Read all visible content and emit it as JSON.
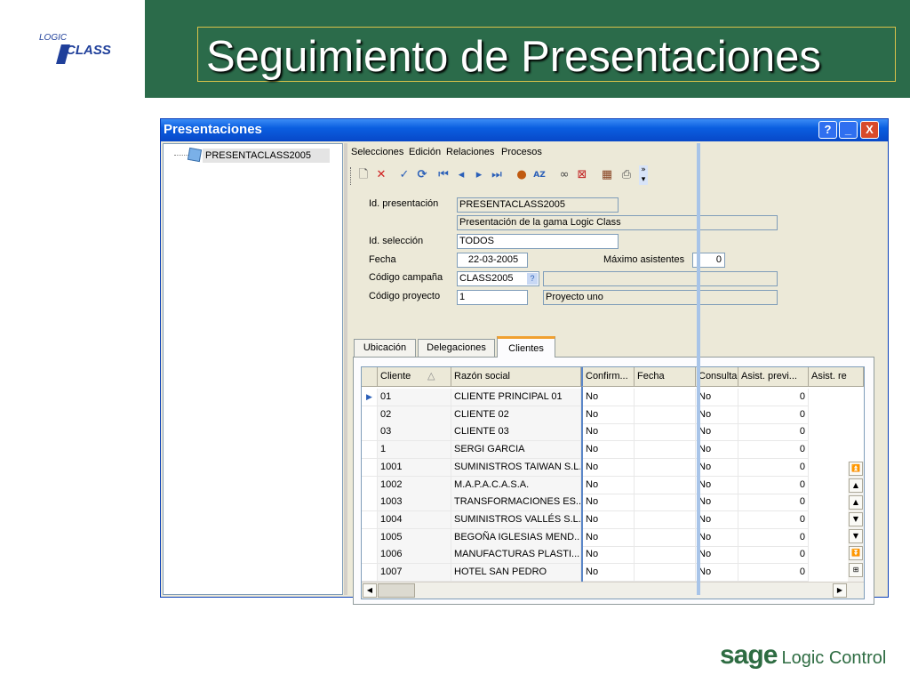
{
  "slide": {
    "title": "Seguimiento de Presentaciones",
    "logo_top": "LOGIC",
    "logo_bottom": "CLASS",
    "brand_sage": "sage",
    "brand_name": "Logic Control",
    "colors": {
      "header_green": "#2b6b4a",
      "title_border": "#d9c24a",
      "logo_blue": "#1f3f9a"
    }
  },
  "window": {
    "title": "Presentaciones",
    "buttons": [
      "?",
      "_",
      "X"
    ],
    "tree": {
      "node": "PRESENTACLASS2005"
    },
    "menu": [
      "Selecciones",
      "Edición",
      "Relaciones",
      "Procesos"
    ],
    "toolbar_icons": [
      "new-document-icon",
      "delete-icon",
      "confirm-check-icon",
      "refresh-icon",
      "first-record-icon",
      "previous-record-icon",
      "next-record-icon",
      "last-record-icon",
      "microphone-icon",
      "sort-az-icon",
      "glasses-icon",
      "filter-clear-icon",
      "calendar-grid-icon",
      "print-icon",
      "toolbar-overflow-icon"
    ]
  },
  "form": {
    "id_presentacion": {
      "label": "Id. presentación",
      "value": "PRESENTACLASS2005",
      "desc": "Presentación de la gama Logic Class"
    },
    "id_seleccion": {
      "label": "Id. selección",
      "value": "TODOS"
    },
    "fecha": {
      "label": "Fecha",
      "value": "22-03-2005"
    },
    "maximo": {
      "label": "Máximo asistentes",
      "value": "0"
    },
    "codigo_campana": {
      "label": "Código campaña",
      "value": "CLASS2005",
      "lookup": "?"
    },
    "codigo_proyecto": {
      "label": "Código proyecto",
      "value": "1",
      "desc": "Proyecto uno"
    }
  },
  "tabs": [
    "Ubicación",
    "Delegaciones",
    "Clientes"
  ],
  "grid": {
    "columns": [
      "Cliente",
      "Razón social",
      "Confirm...",
      "Fecha",
      "Consulta",
      "Asist. previ...",
      "Asist. re"
    ],
    "rows": [
      [
        "01",
        "CLIENTE PRINCIPAL 01",
        "No",
        "",
        "No",
        "0"
      ],
      [
        "02",
        "CLIENTE 02",
        "No",
        "",
        "No",
        "0"
      ],
      [
        "03",
        "CLIENTE 03",
        "No",
        "",
        "No",
        "0"
      ],
      [
        "1",
        "SERGI GARCIA",
        "No",
        "",
        "No",
        "0"
      ],
      [
        "1001",
        "SUMINISTROS TAIWAN S.L.",
        "No",
        "",
        "No",
        "0"
      ],
      [
        "1002",
        "M.A.P.A.C.A.S.A.",
        "No",
        "",
        "No",
        "0"
      ],
      [
        "1003",
        "TRANSFORMACIONES ES...",
        "No",
        "",
        "No",
        "0"
      ],
      [
        "1004",
        "SUMINISTROS VALLÉS S.L.",
        "No",
        "",
        "No",
        "0"
      ],
      [
        "1005",
        "BEGOÑA IGLESIAS MEND...",
        "No",
        "",
        "No",
        "0"
      ],
      [
        "1006",
        "MANUFACTURAS PLASTI...",
        "No",
        "",
        "No",
        "0"
      ],
      [
        "1007",
        "HOTEL SAN PEDRO",
        "No",
        "",
        "No",
        "0"
      ]
    ]
  }
}
